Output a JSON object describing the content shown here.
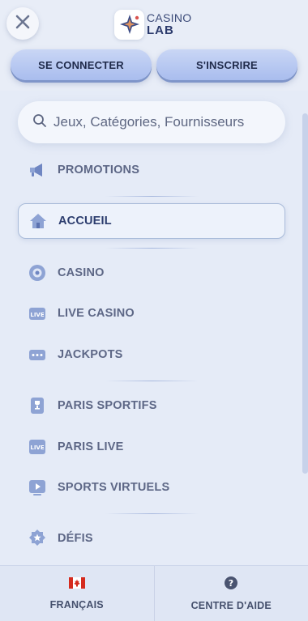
{
  "header": {
    "logo": {
      "line1": "CASINO",
      "line2": "LAB"
    },
    "login_label": "SE CONNECTER",
    "register_label": "S'INSCRIRE"
  },
  "search": {
    "placeholder": "Jeux, Catégories, Fournisseurs"
  },
  "menu": {
    "items": [
      {
        "label": "PROMOTIONS",
        "icon": "megaphone-icon"
      },
      {
        "label": "ACCUEIL",
        "icon": "home-icon",
        "active": true
      },
      {
        "label": "CASINO",
        "icon": "casino-chip-icon"
      },
      {
        "label": "LIVE CASINO",
        "icon": "live-casino-icon"
      },
      {
        "label": "JACKPOTS",
        "icon": "jackpot-icon"
      },
      {
        "label": "PARIS SPORTIFS",
        "icon": "trophy-icon"
      },
      {
        "label": "PARIS LIVE",
        "icon": "live-bet-icon"
      },
      {
        "label": "SPORTS VIRTUELS",
        "icon": "play-icon"
      },
      {
        "label": "DÉFIS",
        "icon": "badge-star-icon"
      }
    ]
  },
  "footer": {
    "language_label": "FRANÇAIS",
    "help_label": "CENTRE D'AIDE"
  },
  "colors": {
    "accent": "#a9bdee",
    "background": "#e5ebf7",
    "text": "#5d6786",
    "active_text": "#2c3d6e"
  }
}
